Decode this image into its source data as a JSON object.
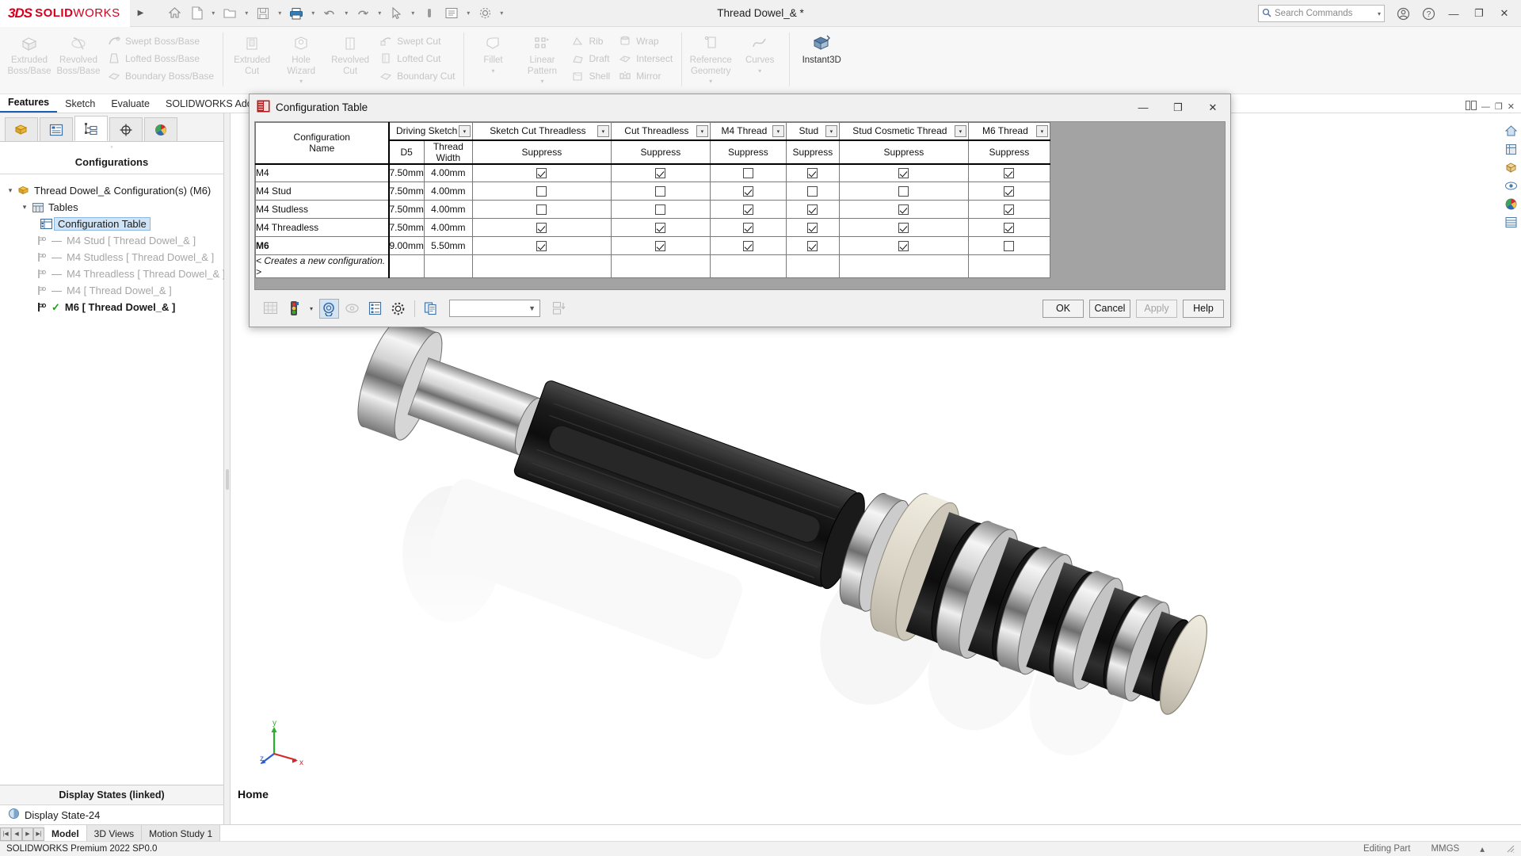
{
  "titlebar": {
    "brand_ds": "3DS",
    "brand_solid": "SOLID",
    "brand_works": "WORKS",
    "document_title": "Thread Dowel_& *",
    "search_placeholder": "Search Commands",
    "quick_access": [
      {
        "name": "home-icon",
        "label": "Home"
      },
      {
        "name": "new-document-icon",
        "label": "New"
      },
      {
        "name": "open-icon",
        "label": "Open"
      },
      {
        "name": "save-icon",
        "label": "Save"
      },
      {
        "name": "print-icon",
        "label": "Print"
      },
      {
        "name": "undo-icon",
        "label": "Undo"
      },
      {
        "name": "redo-icon",
        "label": "Redo"
      },
      {
        "name": "select-icon",
        "label": "Select"
      },
      {
        "name": "magnifier-icon",
        "label": "Magnified View"
      },
      {
        "name": "options-icon",
        "label": "Options"
      },
      {
        "name": "settings-icon",
        "label": "Settings"
      }
    ],
    "window_buttons": {
      "minimize": "—",
      "restore": "❐",
      "close": "✕"
    },
    "help_icon": "?",
    "account_icon": "account"
  },
  "ribbon": {
    "tabs": [
      {
        "label": "Features",
        "active": true
      },
      {
        "label": "Sketch",
        "active": false
      },
      {
        "label": "Evaluate",
        "active": false
      },
      {
        "label": "SOLIDWORKS Add-Ins",
        "active": false
      }
    ],
    "groups": [
      {
        "big": [
          {
            "label_line1": "Extruded",
            "label_line2": "Boss/Base",
            "icon": "extruded-boss-icon",
            "enabled": false
          },
          {
            "label_line1": "Revolved",
            "label_line2": "Boss/Base",
            "icon": "revolved-boss-icon",
            "enabled": false
          }
        ],
        "small": [
          {
            "label": "Swept Boss/Base",
            "icon": "swept-boss-icon"
          },
          {
            "label": "Lofted Boss/Base",
            "icon": "lofted-boss-icon"
          },
          {
            "label": "Boundary Boss/Base",
            "icon": "boundary-boss-icon"
          }
        ]
      },
      {
        "big": [
          {
            "label_line1": "Extruded",
            "label_line2": "Cut",
            "icon": "extruded-cut-icon",
            "enabled": false
          },
          {
            "label_line1": "Hole",
            "label_line2": "Wizard",
            "icon": "hole-wizard-icon",
            "enabled": false,
            "caret": true
          },
          {
            "label_line1": "Revolved",
            "label_line2": "Cut",
            "icon": "revolved-cut-icon",
            "enabled": false
          }
        ],
        "small": [
          {
            "label": "Swept Cut",
            "icon": "swept-cut-icon"
          },
          {
            "label": "Lofted Cut",
            "icon": "lofted-cut-icon"
          },
          {
            "label": "Boundary Cut",
            "icon": "boundary-cut-icon"
          }
        ]
      },
      {
        "big": [
          {
            "label_line1": "Fillet",
            "label_line2": "",
            "icon": "fillet-icon",
            "enabled": false,
            "caret": true
          },
          {
            "label_line1": "Linear",
            "label_line2": "Pattern",
            "icon": "linear-pattern-icon",
            "enabled": false,
            "caret": true
          }
        ],
        "small": [
          {
            "label": "Rib",
            "icon": "rib-icon"
          },
          {
            "label": "Draft",
            "icon": "draft-icon"
          },
          {
            "label": "Shell",
            "icon": "shell-icon"
          }
        ],
        "small2": [
          {
            "label": "Wrap",
            "icon": "wrap-icon"
          },
          {
            "label": "Intersect",
            "icon": "intersect-icon"
          },
          {
            "label": "Mirror",
            "icon": "mirror-icon"
          }
        ]
      },
      {
        "big": [
          {
            "label_line1": "Reference",
            "label_line2": "Geometry",
            "icon": "reference-geometry-icon",
            "enabled": false,
            "caret": true
          },
          {
            "label_line1": "Curves",
            "label_line2": "",
            "icon": "curves-icon",
            "enabled": false,
            "caret": true
          }
        ],
        "small": []
      },
      {
        "big": [
          {
            "label_line1": "Instant3D",
            "label_line2": "",
            "icon": "instant3d-icon",
            "enabled": true
          }
        ],
        "small": []
      }
    ]
  },
  "left_panel": {
    "tabs": [
      {
        "name": "feature-manager-tab",
        "icon": "feature-tree-icon",
        "active": false
      },
      {
        "name": "property-manager-tab",
        "icon": "property-list-icon",
        "active": false
      },
      {
        "name": "configuration-manager-tab",
        "icon": "configuration-icon",
        "active": true
      },
      {
        "name": "dimxpert-manager-tab",
        "icon": "dimxpert-icon",
        "active": false
      },
      {
        "name": "display-manager-tab",
        "icon": "appearance-icon",
        "active": false
      }
    ],
    "title": "Configurations",
    "tree": [
      {
        "label": "Thread Dowel_& Configuration(s)  (M6)",
        "level": 0,
        "icon": "configurations-root-icon",
        "twisty": "▾",
        "dim": false,
        "selected": false,
        "bold": false
      },
      {
        "label": "Tables",
        "level": 1,
        "icon": "tables-folder-icon",
        "twisty": "▾",
        "dim": false,
        "selected": false,
        "bold": false
      },
      {
        "label": "Configuration Table",
        "level": 2,
        "icon": "configuration-table-icon",
        "twisty": "",
        "dim": false,
        "selected": true,
        "bold": false
      },
      {
        "label": "M4 Stud [ Thread Dowel_& ]",
        "level": 2,
        "icon": "configuration-flag-icon",
        "twisty": "",
        "dim": true,
        "selected": false,
        "bold": false,
        "dash": "—"
      },
      {
        "label": "M4 Studless [ Thread Dowel_& ]",
        "level": 2,
        "icon": "configuration-flag-icon",
        "twisty": "",
        "dim": true,
        "selected": false,
        "bold": false,
        "dash": "—"
      },
      {
        "label": "M4 Threadless [ Thread Dowel_& ]",
        "level": 2,
        "icon": "configuration-flag-icon",
        "twisty": "",
        "dim": true,
        "selected": false,
        "bold": false,
        "dash": "—"
      },
      {
        "label": "M4 [ Thread Dowel_& ]",
        "level": 2,
        "icon": "configuration-flag-icon",
        "twisty": "",
        "dim": true,
        "selected": false,
        "bold": false,
        "dash": "—"
      },
      {
        "label": "M6 [ Thread Dowel_& ]",
        "level": 2,
        "icon": "configuration-flag-icon",
        "twisty": "",
        "dim": false,
        "selected": false,
        "bold": true,
        "check": "✓"
      }
    ],
    "display_states": {
      "header": "Display States (linked)",
      "item": "Display State-24",
      "item_icon": "display-state-icon"
    }
  },
  "dialog": {
    "title": "Configuration Table",
    "title_icon": "solidworks-table-icon",
    "minimize": "—",
    "maximize": "❐",
    "close": "✕",
    "footer_icons": [
      {
        "name": "grid-toggle-icon",
        "active": false
      },
      {
        "name": "traffic-light-icon",
        "active": false,
        "caret": true
      },
      {
        "name": "link-values-icon",
        "active": true
      },
      {
        "name": "hide-show-icon",
        "active": false
      },
      {
        "name": "list-properties-icon",
        "active": false
      },
      {
        "name": "settings-gear-icon",
        "active": false
      },
      {
        "name": "copy-config-icon",
        "active": false
      },
      {
        "name": "sort-table-icon",
        "active": false
      }
    ],
    "footer_select_value": "",
    "buttons": [
      {
        "label": "OK",
        "name": "ok-button",
        "disabled": false
      },
      {
        "label": "Cancel",
        "name": "cancel-button",
        "disabled": false
      },
      {
        "label": "Apply",
        "name": "apply-button",
        "disabled": true
      },
      {
        "label": "Help",
        "name": "help-button",
        "disabled": false
      }
    ]
  },
  "table": {
    "corner_header_line1": "Configuration",
    "corner_header_line2": "Name",
    "groups": [
      {
        "label": "Driving Sketch",
        "subs": [
          "D5",
          "Thread Width"
        ],
        "type": "value"
      },
      {
        "label": "Sketch Cut Threadless",
        "subs": [
          "Suppress"
        ],
        "type": "check"
      },
      {
        "label": "Cut Threadless",
        "subs": [
          "Suppress"
        ],
        "type": "check"
      },
      {
        "label": "M4 Thread",
        "subs": [
          "Suppress"
        ],
        "type": "check"
      },
      {
        "label": "Stud",
        "subs": [
          "Suppress"
        ],
        "type": "check"
      },
      {
        "label": "Stud Cosmetic Thread",
        "subs": [
          "Suppress"
        ],
        "type": "check"
      },
      {
        "label": "M6 Thread",
        "subs": [
          "Suppress"
        ],
        "type": "check"
      }
    ],
    "rows": [
      {
        "name": "M4",
        "bold": false,
        "d5": "7.50mm",
        "thread_width": "4.00mm",
        "checks": [
          true,
          true,
          false,
          true,
          true,
          true
        ]
      },
      {
        "name": "M4 Stud",
        "bold": false,
        "d5": "7.50mm",
        "thread_width": "4.00mm",
        "checks": [
          false,
          false,
          true,
          false,
          false,
          true
        ]
      },
      {
        "name": "M4 Studless",
        "bold": false,
        "d5": "7.50mm",
        "thread_width": "4.00mm",
        "checks": [
          false,
          false,
          true,
          true,
          true,
          true
        ]
      },
      {
        "name": "M4 Threadless",
        "bold": false,
        "d5": "7.50mm",
        "thread_width": "4.00mm",
        "checks": [
          true,
          true,
          true,
          true,
          true,
          true
        ]
      },
      {
        "name": "M6",
        "bold": true,
        "d5": "9.00mm",
        "thread_width": "5.50mm",
        "checks": [
          true,
          true,
          true,
          true,
          true,
          false
        ]
      }
    ],
    "new_row_label": "< Creates a new configuration. >"
  },
  "graphics": {
    "home_label": "Home",
    "triad_axes": {
      "x": "x",
      "y": "y",
      "z": "z"
    },
    "right_tools": [
      {
        "name": "view-home-icon"
      },
      {
        "name": "view-orientation-icon"
      },
      {
        "name": "display-style-icon"
      },
      {
        "name": "hide-show-items-icon"
      },
      {
        "name": "appearances-icon"
      },
      {
        "name": "scene-icon"
      }
    ]
  },
  "bottom": {
    "nav_buttons": [
      "|◀",
      "◀",
      "▶",
      "▶|"
    ],
    "tabs": [
      {
        "label": "Model",
        "active": true
      },
      {
        "label": "3D Views",
        "active": false
      },
      {
        "label": "Motion Study 1",
        "active": false
      }
    ]
  },
  "statusbar": {
    "left": "SOLIDWORKS Premium 2022 SP0.0",
    "editing": "Editing Part",
    "units": "MMGS",
    "units_caret": "▴"
  },
  "colors": {
    "brand_red": "#d6001c",
    "selection_blue": "#cfe4f7",
    "accent_blue": "#1a5fb4",
    "dialog_body": "#a3a3a3",
    "green_check": "#1d9b1d"
  }
}
